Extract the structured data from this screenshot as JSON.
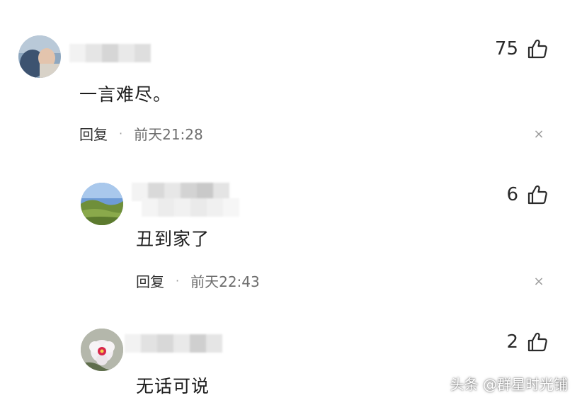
{
  "comments": [
    {
      "text": "一言难尽。",
      "likes": "75",
      "reply_label": "回复",
      "separator": "·",
      "time": "前天21:28",
      "close": "×"
    },
    {
      "text": "丑到家了",
      "likes": "6",
      "reply_label": "回复",
      "separator": "·",
      "time": "前天22:43",
      "close": "×"
    },
    {
      "text": "无话可说",
      "likes": "2"
    }
  ],
  "watermark": "头条 @群星时光铺",
  "icons": {
    "like": "thumbs-up-icon",
    "close": "close-icon"
  },
  "colors": {
    "text": "#1c1c1c",
    "meta": "#6e6e6e"
  }
}
